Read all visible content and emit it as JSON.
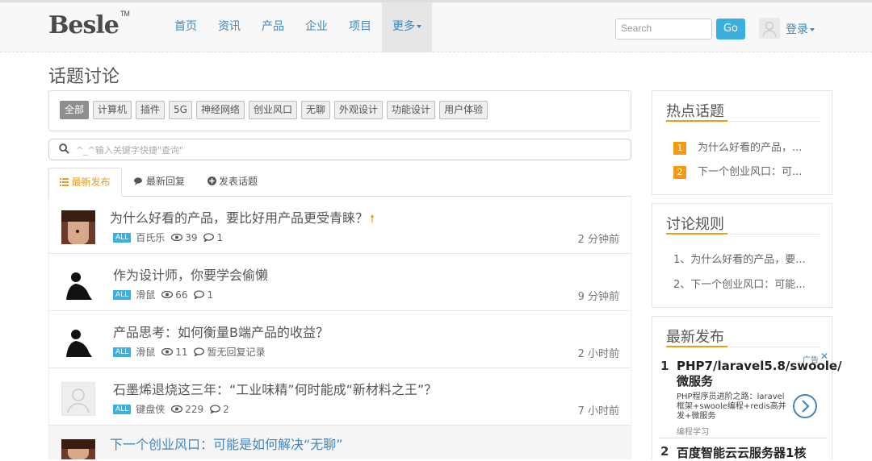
{
  "header": {
    "logo": "Besle",
    "logo_tm": "TM",
    "nav": [
      {
        "label": "首页"
      },
      {
        "label": "资讯"
      },
      {
        "label": "产品"
      },
      {
        "label": "企业"
      },
      {
        "label": "项目"
      },
      {
        "label": "更多"
      }
    ],
    "search_placeholder": "Search",
    "go_label": "Go",
    "login_label": "登录"
  },
  "page_title": "话题讨论",
  "tags": [
    "全部",
    "计算机",
    "插件",
    "5G",
    "神经网络",
    "创业风口",
    "无聊",
    "外观设计",
    "功能设计",
    "用户体验"
  ],
  "keyword_placeholder": "^_^输入关键字快捷\"查询\"",
  "tabs": [
    {
      "label": "最新发布"
    },
    {
      "label": "最新回复"
    },
    {
      "label": "发表话题"
    }
  ],
  "topics": [
    {
      "title": "为什么好看的产品，要比好用产品更受青睐？",
      "badge": "ALL",
      "author": "百氏乐",
      "views": "39",
      "replies": "1",
      "time": "2 分钟前"
    },
    {
      "title": "作为设计师，你要学会偷懒",
      "badge": "ALL",
      "author": "滑鼠",
      "views": "66",
      "replies": "1",
      "time": "9 分钟前"
    },
    {
      "title": "产品思考：如何衡量B端产品的收益？",
      "badge": "ALL",
      "author": "滑鼠",
      "views": "11",
      "replies": "暂无回复记录",
      "time": "2 小时前"
    },
    {
      "title": "石墨烯退烧这三年：“工业味精”何时能成“新材料之王”？",
      "badge": "ALL",
      "author": "键盘侠",
      "views": "229",
      "replies": "2",
      "time": "7 小时前"
    },
    {
      "title": "下一个创业风口：可能是如何解决“无聊”"
    }
  ],
  "sidebar": {
    "hot": {
      "title": "热点话题",
      "items": [
        {
          "num": "1",
          "text": "为什么好看的产品，..."
        },
        {
          "num": "2",
          "text": "下一个创业风口：可..."
        }
      ]
    },
    "rules": {
      "title": "讨论规则",
      "items": [
        "1、为什么好看的产品，要...",
        "2、下一个创业风口：可能..."
      ]
    },
    "latest": {
      "title": "最新发布",
      "ad_label": "广告",
      "ad_close": "✕",
      "ads": [
        {
          "num": "1",
          "title": "PHP7/laravel5.8/swoole/微服务",
          "desc": "PHP程序员进阶之路：laravel框架+swoole编程+redis高并发+微服务",
          "source": "编程学习"
        },
        {
          "num": "2",
          "title": "百度智能云云服务器1核"
        }
      ]
    }
  },
  "colors": {
    "accent": "#f39a12",
    "link": "#3f87c0",
    "button": "#3bb0de"
  }
}
